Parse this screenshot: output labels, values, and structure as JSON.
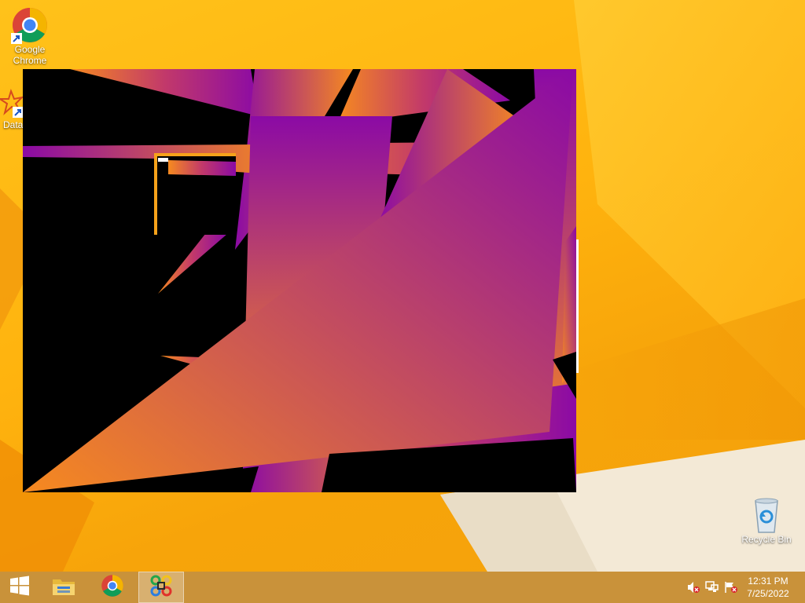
{
  "desktop": {
    "icons": [
      {
        "label": "Google Chrome"
      },
      {
        "label": "Data"
      },
      {
        "label": "Recycle Bin"
      }
    ]
  },
  "app": {
    "name": "fullscreen-graphics-app"
  },
  "taskbar": {
    "buttons": [
      "start-icon",
      "file-explorer-icon",
      "chrome-icon",
      "app-icon"
    ],
    "tray": [
      "volume-muted-icon",
      "network-icon",
      "action-center-flag-icon"
    ],
    "time": "12:31 PM",
    "date": "7/25/2022"
  },
  "colors": {
    "accent_orange": "#f68a1f",
    "accent_purple": "#8b0aa5",
    "taskbar": "#c9923a"
  }
}
